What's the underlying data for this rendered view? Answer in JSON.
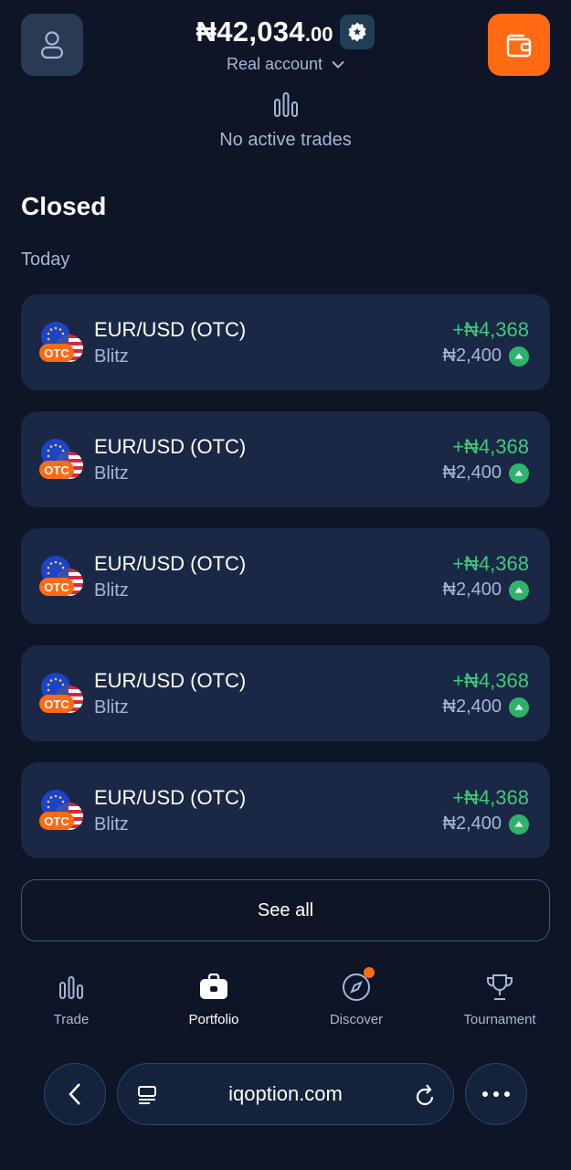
{
  "header": {
    "balance_main": "₦42,034",
    "balance_decimals": ".00",
    "account_label": "Real account"
  },
  "status": {
    "no_trades": "No active trades"
  },
  "section": {
    "title": "Closed",
    "subtitle": "Today"
  },
  "trades": [
    {
      "asset": "EUR/USD (OTC)",
      "type": "Blitz",
      "profit": "+₦4,368",
      "amount": "₦2,400",
      "direction": "up",
      "tag": "OTC"
    },
    {
      "asset": "EUR/USD (OTC)",
      "type": "Blitz",
      "profit": "+₦4,368",
      "amount": "₦2,400",
      "direction": "up",
      "tag": "OTC"
    },
    {
      "asset": "EUR/USD (OTC)",
      "type": "Blitz",
      "profit": "+₦4,368",
      "amount": "₦2,400",
      "direction": "up",
      "tag": "OTC"
    },
    {
      "asset": "EUR/USD (OTC)",
      "type": "Blitz",
      "profit": "+₦4,368",
      "amount": "₦2,400",
      "direction": "up",
      "tag": "OTC"
    },
    {
      "asset": "EUR/USD (OTC)",
      "type": "Blitz",
      "profit": "+₦4,368",
      "amount": "₦2,400",
      "direction": "up",
      "tag": "OTC"
    }
  ],
  "see_all_label": "See all",
  "nav": {
    "items": [
      {
        "label": "Trade",
        "icon": "bar-chart-icon",
        "active": false
      },
      {
        "label": "Portfolio",
        "icon": "briefcase-icon",
        "active": true
      },
      {
        "label": "Discover",
        "icon": "compass-icon",
        "active": false,
        "notification": true
      },
      {
        "label": "Tournament",
        "icon": "trophy-icon",
        "active": false
      }
    ]
  },
  "browser": {
    "url": "iqoption.com"
  },
  "colors": {
    "background": "#0d1526",
    "card": "#1a2845",
    "accent": "#ff6a13",
    "profit": "#3fc97c",
    "muted": "#a8b6d6"
  }
}
